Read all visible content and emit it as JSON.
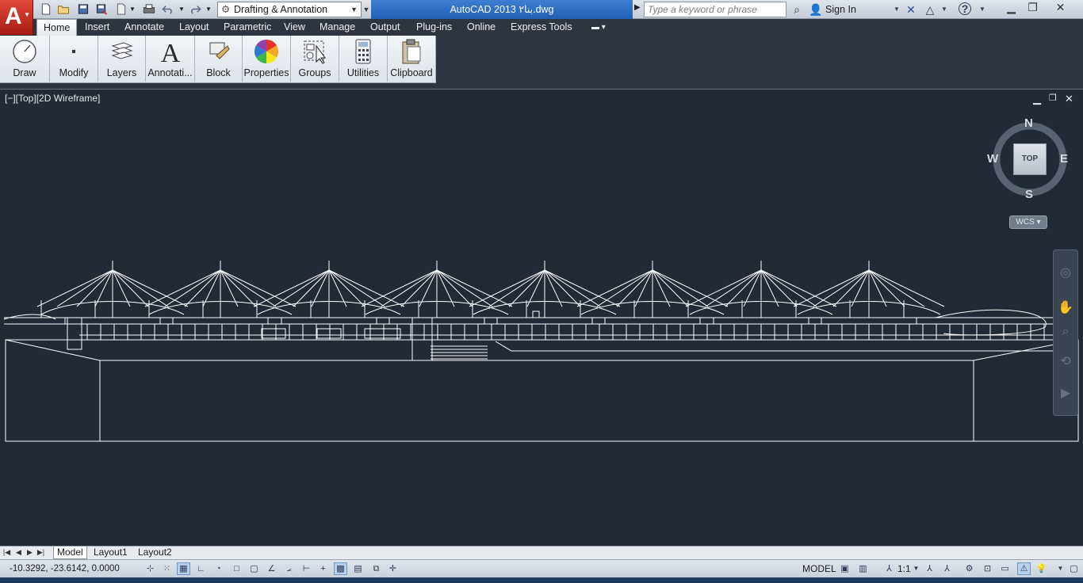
{
  "titlebar": {
    "app_letter": "A",
    "workspace": "Drafting & Annotation",
    "window_title": "AutoCAD 2013    بنا۲.dwg",
    "search_placeholder": "Type a keyword or phrase",
    "sign_in": "Sign In",
    "help": "?"
  },
  "tabs": [
    "Home",
    "Insert",
    "Annotate",
    "Layout",
    "Parametric",
    "View",
    "Manage",
    "Output",
    "Plug-ins",
    "Online",
    "Express Tools"
  ],
  "ribbon_panels": [
    {
      "label": "Draw",
      "icon": "draw-icon"
    },
    {
      "label": "Modify",
      "icon": "modify-icon"
    },
    {
      "label": "Layers",
      "icon": "layers-icon"
    },
    {
      "label": "Annotati...",
      "icon": "annotation-icon"
    },
    {
      "label": "Block",
      "icon": "block-icon"
    },
    {
      "label": "Properties",
      "icon": "properties-icon"
    },
    {
      "label": "Groups",
      "icon": "groups-icon"
    },
    {
      "label": "Utilities",
      "icon": "utilities-icon"
    },
    {
      "label": "Clipboard",
      "icon": "clipboard-icon"
    }
  ],
  "viewport": {
    "label": "[−][Top][2D Wireframe]",
    "compass": {
      "n": "N",
      "s": "S",
      "e": "E",
      "w": "W"
    },
    "cube_face": "TOP",
    "ucs": "WCS"
  },
  "layout_tabs": [
    "Model",
    "Layout1",
    "Layout2"
  ],
  "status": {
    "coordinates": "-10.3292, -23.6142, 0.0000",
    "model": "MODEL",
    "annotation_scale": "1:1"
  },
  "colors": {
    "canvas": "#222a35",
    "lines": "#ffffff",
    "title_highlight": "#2a6dc4",
    "app_button": "#c8281c"
  }
}
